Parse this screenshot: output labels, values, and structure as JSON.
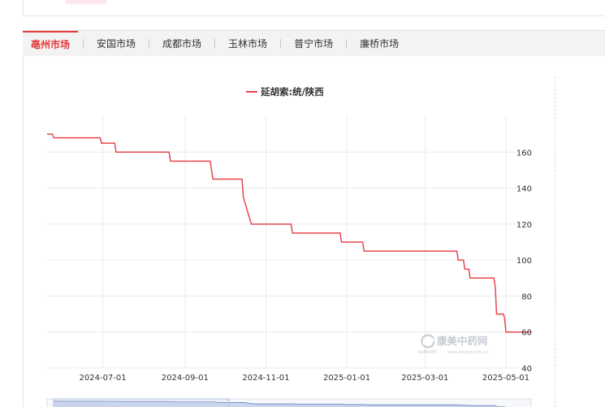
{
  "tabs": [
    {
      "label": "亳州市场",
      "active": true
    },
    {
      "label": "安国市场",
      "active": false
    },
    {
      "label": "成都市场",
      "active": false
    },
    {
      "label": "玉林市场",
      "active": false
    },
    {
      "label": "普宁市场",
      "active": false
    },
    {
      "label": "廉桥市场",
      "active": false
    }
  ],
  "colors": {
    "accent": "#e53b3b",
    "series": "#e8474e",
    "grid": "#ebebeb",
    "slider_fill": "#c9d6ee",
    "slider_line": "#7a8fc2"
  },
  "watermark": {
    "text": "康美中药网",
    "brand": "KANGMEI",
    "url": "www.kmzyw.com.cn",
    "icon": "kangmei-logo-icon"
  },
  "chart_data": {
    "type": "line",
    "title": "",
    "xlabel": "",
    "ylabel": "",
    "legend": {
      "position": "top-center",
      "entries": [
        "延胡索:统/陕西"
      ]
    },
    "x_axis": {
      "type": "date",
      "range": [
        "2024-05-20",
        "2025-05-20"
      ],
      "ticks": [
        "2024-07-01",
        "2024-09-01",
        "2024-11-01",
        "2025-01-01",
        "2025-03-01",
        "2025-05-01"
      ]
    },
    "y_axis": {
      "position": "right",
      "range": [
        40,
        180
      ],
      "ticks": [
        40,
        60,
        80,
        100,
        120,
        140,
        160
      ],
      "grid": true
    },
    "series": [
      {
        "name": "延胡索:统/陕西",
        "step": true,
        "points": [
          [
            "2024-05-20",
            170
          ],
          [
            "2024-05-24",
            170
          ],
          [
            "2024-05-25",
            168
          ],
          [
            "2024-06-29",
            168
          ],
          [
            "2024-06-30",
            165
          ],
          [
            "2024-07-10",
            165
          ],
          [
            "2024-07-11",
            160
          ],
          [
            "2024-08-20",
            160
          ],
          [
            "2024-08-21",
            155
          ],
          [
            "2024-09-20",
            155
          ],
          [
            "2024-09-21",
            150
          ],
          [
            "2024-09-22",
            145
          ],
          [
            "2024-10-14",
            145
          ],
          [
            "2024-10-15",
            135
          ],
          [
            "2024-10-17",
            130
          ],
          [
            "2024-10-19",
            125
          ],
          [
            "2024-10-21",
            120
          ],
          [
            "2024-11-20",
            120
          ],
          [
            "2024-11-21",
            115
          ],
          [
            "2024-12-27",
            115
          ],
          [
            "2024-12-28",
            110
          ],
          [
            "2025-01-13",
            110
          ],
          [
            "2025-01-14",
            105
          ],
          [
            "2025-03-25",
            105
          ],
          [
            "2025-03-26",
            100
          ],
          [
            "2025-03-30",
            100
          ],
          [
            "2025-03-31",
            95
          ],
          [
            "2025-04-03",
            95
          ],
          [
            "2025-04-04",
            90
          ],
          [
            "2025-04-22",
            90
          ],
          [
            "2025-04-23",
            85
          ],
          [
            "2025-04-24",
            70
          ],
          [
            "2025-04-29",
            70
          ],
          [
            "2025-04-30",
            68
          ],
          [
            "2025-05-01",
            60
          ],
          [
            "2025-05-20",
            60
          ]
        ]
      }
    ],
    "data_zoom": {
      "visible": true,
      "start_fraction": 0,
      "end_fraction": 1
    }
  }
}
